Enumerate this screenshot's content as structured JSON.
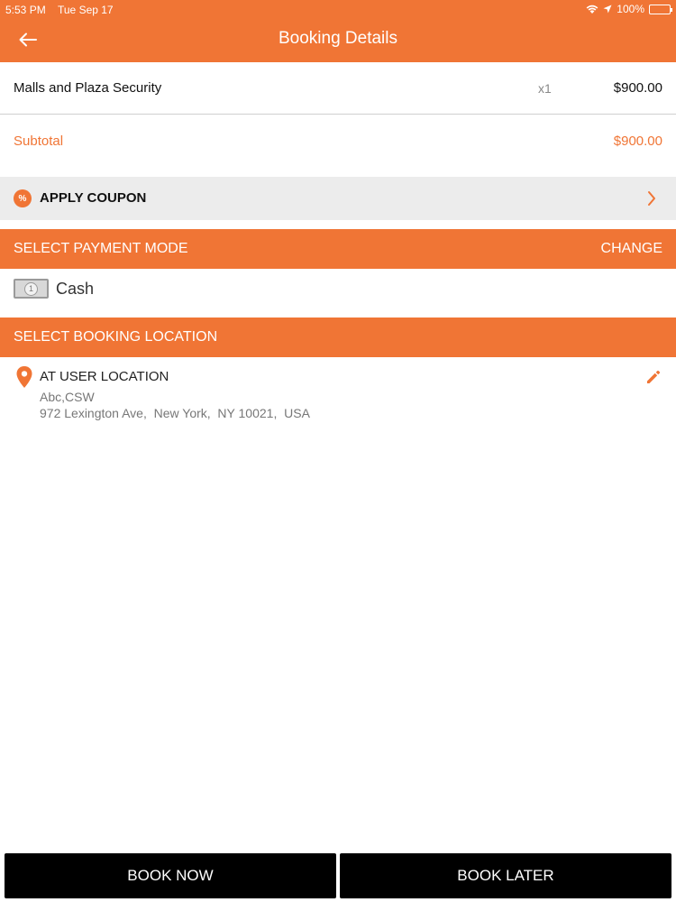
{
  "status_bar": {
    "time": "5:53 PM",
    "date": "Tue Sep 17",
    "battery": "100%"
  },
  "header": {
    "title": "Booking Details",
    "back_icon": "back-arrow-icon"
  },
  "order": {
    "item_name": "Malls and Plaza Security",
    "item_qty": "x1",
    "item_price": "$900.00",
    "subtotal_label": "Subtotal",
    "subtotal_value": "$900.00"
  },
  "coupon": {
    "icon_text": "%",
    "label": "APPLY COUPON"
  },
  "payment": {
    "section_label": "SELECT PAYMENT MODE",
    "change_label": "CHANGE",
    "coin_text": "1",
    "method": "Cash"
  },
  "location": {
    "section_label": "SELECT BOOKING LOCATION",
    "type": "AT USER LOCATION",
    "line1": "Abc,CSW",
    "line2": "972 Lexington Ave,  New York,  NY 10021,  USA"
  },
  "actions": {
    "book_now": "BOOK NOW",
    "book_later": "BOOK LATER"
  },
  "colors": {
    "accent": "#f07535",
    "button_bg": "#000000",
    "coupon_bg": "#ececec"
  }
}
